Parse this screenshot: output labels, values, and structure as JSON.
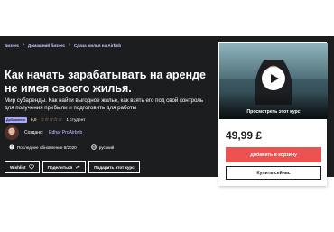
{
  "breadcrumb": {
    "items": [
      "Бизнес",
      "Домашний бизнес",
      "Сдача жилья на Airbnb"
    ],
    "separator": "›"
  },
  "course": {
    "title": "Как начать зарабатывать на аренде не имея своего жилья.",
    "subtitle": "Мир субаренды. Как найти выгодное жилье, как взять его под свой контроль для получения прибыли и подготовить для работы",
    "badge": "Добавлено",
    "rating": "0,0",
    "stars": "☆☆☆☆☆",
    "students": "1 студент",
    "created_by_label": "Создано:",
    "author": "Edhar ProAirbnb",
    "last_updated": "Последнее обновление 8/2020",
    "language": "русский"
  },
  "actions": {
    "wishlist": "Wishlist",
    "share": "Поделиться",
    "gift": "Подарить этот курс"
  },
  "sidebar": {
    "preview_label": "Просмотреть этот курс",
    "price": "49,99 £",
    "add_to_cart": "Добавить в корзину",
    "buy_now": "Купить сейчас"
  },
  "colors": {
    "hero_background": "#1c1d1f",
    "accent_link": "#cec0fc",
    "rating": "#f3ca8c",
    "cart_button": "#ec5252"
  },
  "icons": [
    "chevron-right-icon",
    "alert-icon",
    "globe-icon",
    "heart-icon",
    "share-arrow-icon",
    "play-icon"
  ]
}
